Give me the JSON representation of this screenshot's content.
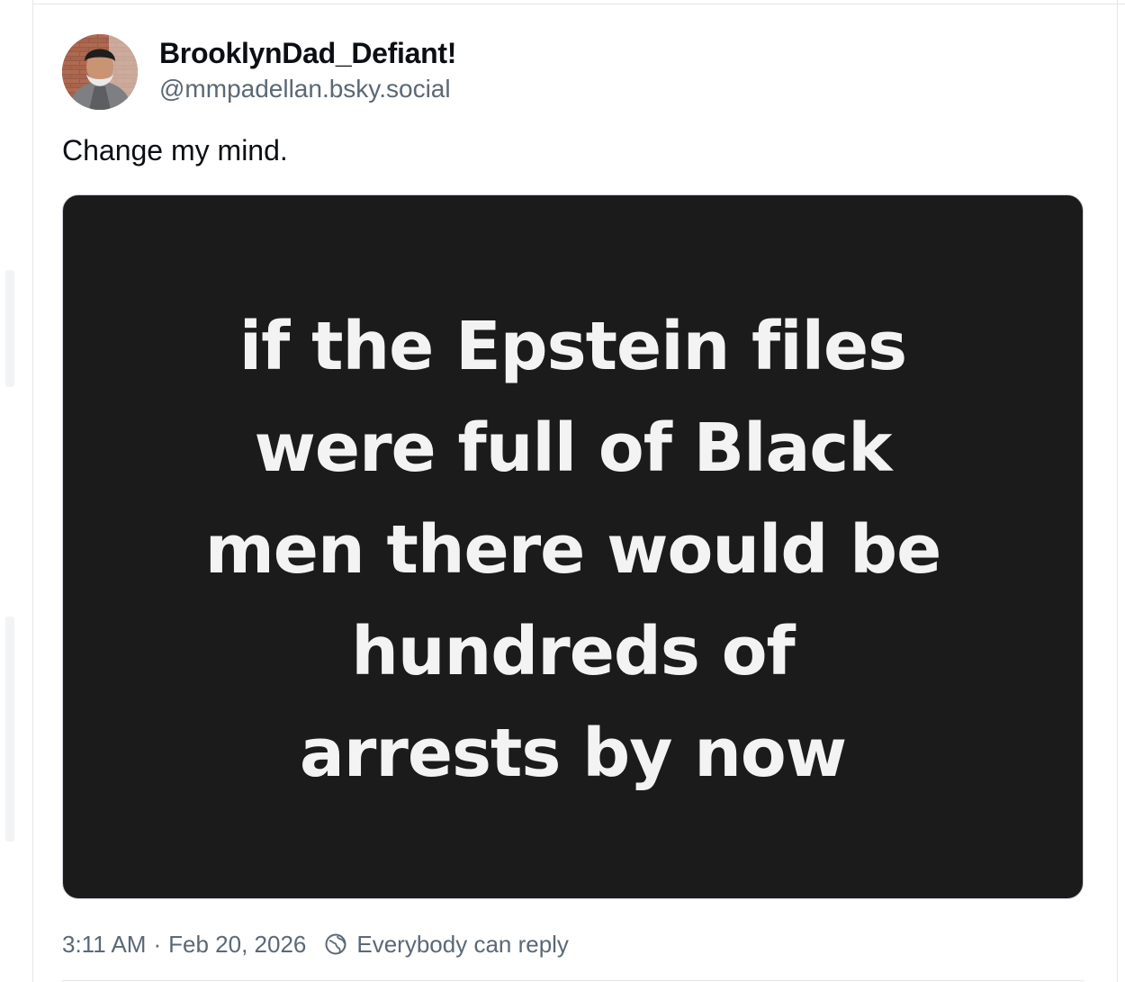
{
  "author": {
    "display_name": "BrooklynDad_Defiant!",
    "handle": "@mmpadellan.bsky.social"
  },
  "post": {
    "text": "Change my mind.",
    "image_text_lines": [
      "if the Epstein files",
      "were full of Black",
      "men there would be",
      "hundreds of",
      "arrests by now"
    ],
    "time": "3:11 AM",
    "separator": "·",
    "date": "Feb 20, 2026",
    "reply_setting": "Everybody can reply"
  },
  "icons": {
    "reply_setting": "globe-icon"
  },
  "colors": {
    "text_primary": "#0b0f14",
    "text_secondary": "#5b6876",
    "image_background": "#1b1b1b",
    "image_text": "#f3f3f3",
    "divider": "#e3e6ea"
  }
}
